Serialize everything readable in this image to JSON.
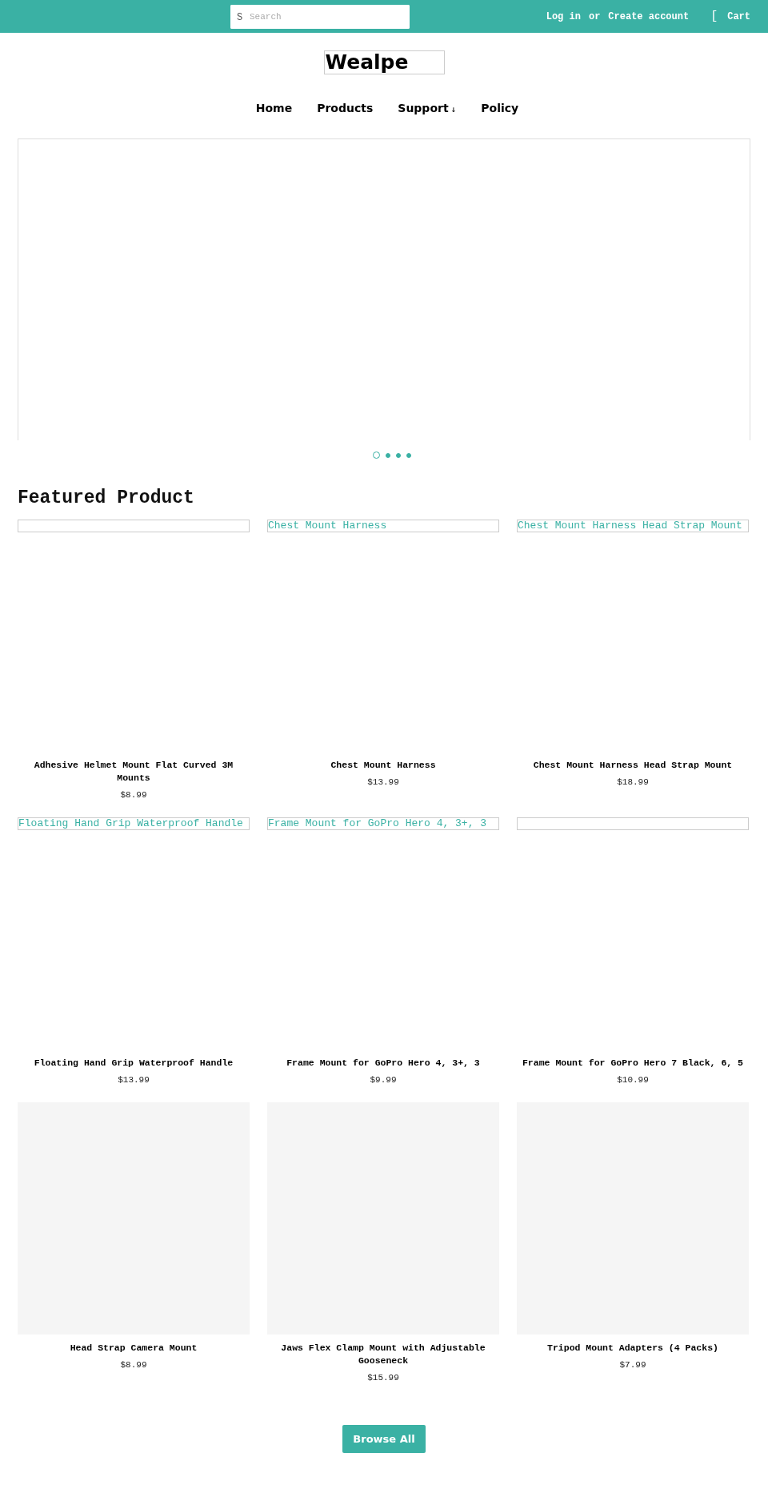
{
  "top_bar": {
    "search": {
      "icon_glyph": "S",
      "placeholder": "Search"
    },
    "login": "Log in",
    "or": "or",
    "create_account": "Create account",
    "cart_glyph": "[",
    "cart": "Cart"
  },
  "logo": "Wealpe",
  "nav": [
    {
      "label": "Home"
    },
    {
      "label": "Products"
    },
    {
      "label": "Support",
      "caret": "↓"
    },
    {
      "label": "Policy"
    }
  ],
  "slider": {
    "dots": [
      {
        "selected": true
      },
      {
        "selected": false
      },
      {
        "selected": false
      },
      {
        "selected": false
      }
    ]
  },
  "featured": {
    "title": "Featured Product",
    "products": [
      {
        "image": {
          "kind": "broken"
        },
        "name": "Adhesive Helmet Mount Flat Curved 3M Mounts",
        "price": "$8.99"
      },
      {
        "image": {
          "kind": "broken",
          "alt": "Chest Mount Harness"
        },
        "name": "Chest Mount Harness",
        "price": "$13.99"
      },
      {
        "image": {
          "kind": "broken",
          "alt": "Chest Mount Harness Head Strap Mount"
        },
        "name": "Chest Mount Harness Head Strap Mount",
        "price": "$18.99"
      },
      {
        "image": {
          "kind": "broken",
          "alt": "Floating Hand Grip Waterproof Handle"
        },
        "name": "Floating Hand Grip Waterproof Handle",
        "price": "$13.99"
      },
      {
        "image": {
          "kind": "broken",
          "alt": "Frame Mount for GoPro Hero 4, 3+, 3"
        },
        "name": "Frame Mount for GoPro Hero 4, 3+, 3",
        "price": "$9.99"
      },
      {
        "image": {
          "kind": "broken"
        },
        "name": "Frame Mount for GoPro Hero 7 Black, 6, 5",
        "price": "$10.99"
      },
      {
        "image": {
          "kind": "placeholder"
        },
        "name": "Head Strap Camera Mount",
        "price": "$8.99"
      },
      {
        "image": {
          "kind": "placeholder"
        },
        "name": "Jaws Flex Clamp Mount with Adjustable Gooseneck",
        "price": "$15.99"
      },
      {
        "image": {
          "kind": "placeholder"
        },
        "name": "Tripod Mount Adapters (4 Packs)",
        "price": "$7.99"
      }
    ],
    "browse_button": "Browse All"
  }
}
